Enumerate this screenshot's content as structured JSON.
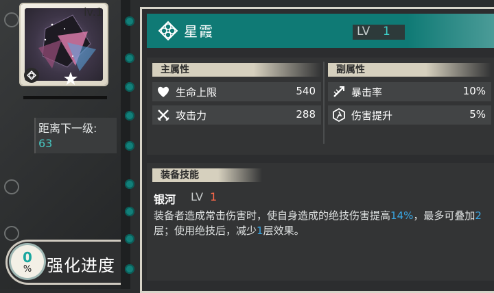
{
  "card": {
    "level": "lv.1"
  },
  "next_level": {
    "label": "距离下一级:",
    "value": "63"
  },
  "enhance": {
    "percent": "0",
    "percent_sign": "%",
    "label": "强化进度"
  },
  "item": {
    "name": "星霞",
    "lv_label": "LV",
    "lv_value": "1"
  },
  "main_stats": {
    "header": "主属性",
    "rows": [
      {
        "icon": "heart-shield-icon",
        "name": "生命上限",
        "value": "540"
      },
      {
        "icon": "crossed-swords-icon",
        "name": "攻击力",
        "value": "288"
      }
    ]
  },
  "sub_stats": {
    "header": "副属性",
    "rows": [
      {
        "icon": "crit-icon",
        "name": "暴击率",
        "value": "10%"
      },
      {
        "icon": "damage-boost-icon",
        "name": "伤害提升",
        "value": "5%"
      }
    ]
  },
  "skill": {
    "header": "装备技能",
    "name": "银河",
    "lv_label": "LV",
    "lv_value": "1",
    "desc_part1": "装备者造成常击伤害时，使自身造成的绝技伤害提高",
    "desc_hl1": "14%",
    "desc_part2": "，最多可叠加",
    "desc_hl2": "2",
    "desc_part3": "层；使用绝技后，减少",
    "desc_hl3": "1",
    "desc_part4": "层效果。"
  },
  "colors": {
    "accent": "#0f7a75",
    "highlight": "#3aa8e6",
    "level_red": "#ff6a4a",
    "teal_text": "#47c6c0"
  }
}
